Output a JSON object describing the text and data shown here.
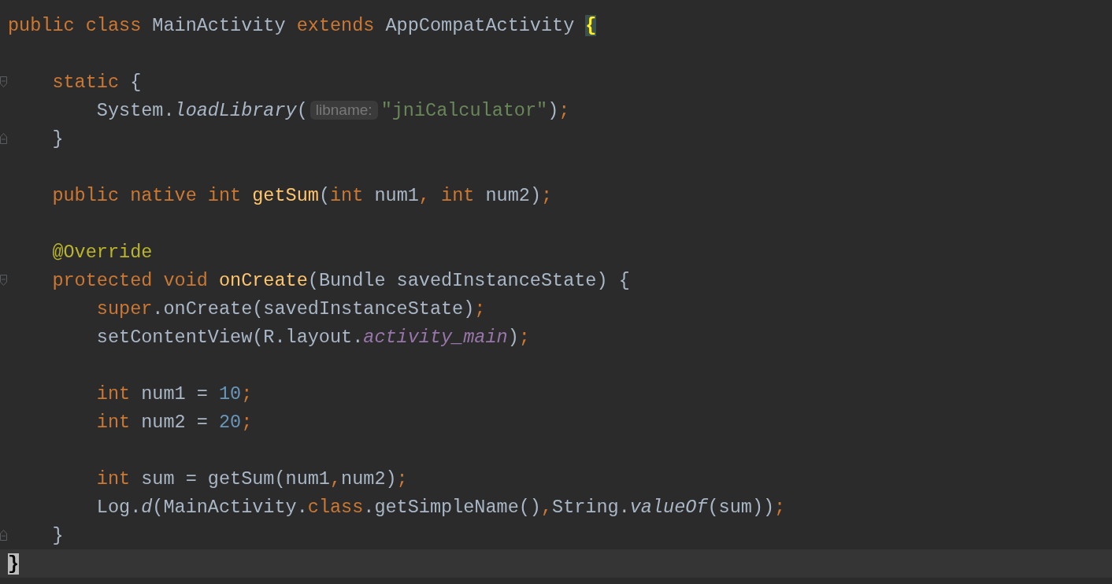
{
  "editor": {
    "lines": [
      {
        "kind": "code",
        "tokens": [
          {
            "text": "public class ",
            "kind": "keyword"
          },
          {
            "text": "MainActivity ",
            "kind": "plain"
          },
          {
            "text": "extends ",
            "kind": "keyword"
          },
          {
            "text": "AppCompatActivity ",
            "kind": "plain"
          },
          {
            "text": "{",
            "kind": "brace-match"
          }
        ]
      },
      {
        "kind": "blank"
      },
      {
        "kind": "code",
        "fold_start": true,
        "tokens": [
          {
            "text": "    static ",
            "kind": "keyword"
          },
          {
            "text": "{",
            "kind": "plain"
          }
        ]
      },
      {
        "kind": "code",
        "tokens": [
          {
            "text": "        System.",
            "kind": "plain"
          },
          {
            "text": "loadLibrary",
            "kind": "italic"
          },
          {
            "text": "(",
            "kind": "plain"
          },
          {
            "text": "libname:",
            "kind": "hint"
          },
          {
            "text": "\"jniCalculator\"",
            "kind": "string"
          },
          {
            "text": ")",
            "kind": "plain"
          },
          {
            "text": ";",
            "kind": "keyword"
          }
        ]
      },
      {
        "kind": "code",
        "fold_end": true,
        "tokens": [
          {
            "text": "    }",
            "kind": "plain"
          }
        ]
      },
      {
        "kind": "blank"
      },
      {
        "kind": "code",
        "tokens": [
          {
            "text": "    public native int ",
            "kind": "keyword"
          },
          {
            "text": "getSum",
            "kind": "method"
          },
          {
            "text": "(",
            "kind": "plain"
          },
          {
            "text": "int ",
            "kind": "keyword"
          },
          {
            "text": "num1",
            "kind": "plain"
          },
          {
            "text": ", ",
            "kind": "keyword"
          },
          {
            "text": "int ",
            "kind": "keyword"
          },
          {
            "text": "num2)",
            "kind": "plain"
          },
          {
            "text": ";",
            "kind": "keyword"
          }
        ]
      },
      {
        "kind": "blank"
      },
      {
        "kind": "code",
        "tokens": [
          {
            "text": "    @Override",
            "kind": "annotation"
          }
        ]
      },
      {
        "kind": "code",
        "fold_start": true,
        "tokens": [
          {
            "text": "    protected void ",
            "kind": "keyword"
          },
          {
            "text": "onCreate",
            "kind": "method"
          },
          {
            "text": "(Bundle savedInstanceState) {",
            "kind": "plain"
          }
        ]
      },
      {
        "kind": "code",
        "tokens": [
          {
            "text": "        super",
            "kind": "keyword"
          },
          {
            "text": ".onCreate(savedInstanceState)",
            "kind": "plain"
          },
          {
            "text": ";",
            "kind": "keyword"
          }
        ]
      },
      {
        "kind": "code",
        "tokens": [
          {
            "text": "        setContentView(R.layout.",
            "kind": "plain"
          },
          {
            "text": "activity_main",
            "kind": "field"
          },
          {
            "text": ")",
            "kind": "plain"
          },
          {
            "text": ";",
            "kind": "keyword"
          }
        ]
      },
      {
        "kind": "blank"
      },
      {
        "kind": "code",
        "tokens": [
          {
            "text": "        int ",
            "kind": "keyword"
          },
          {
            "text": "num1 = ",
            "kind": "plain"
          },
          {
            "text": "10",
            "kind": "number"
          },
          {
            "text": ";",
            "kind": "keyword"
          }
        ]
      },
      {
        "kind": "code",
        "tokens": [
          {
            "text": "        int ",
            "kind": "keyword"
          },
          {
            "text": "num2 = ",
            "kind": "plain"
          },
          {
            "text": "20",
            "kind": "number"
          },
          {
            "text": ";",
            "kind": "keyword"
          }
        ]
      },
      {
        "kind": "blank"
      },
      {
        "kind": "code",
        "tokens": [
          {
            "text": "        int ",
            "kind": "keyword"
          },
          {
            "text": "sum = getSum(num1",
            "kind": "plain"
          },
          {
            "text": ",",
            "kind": "keyword"
          },
          {
            "text": "num2)",
            "kind": "plain"
          },
          {
            "text": ";",
            "kind": "keyword"
          }
        ]
      },
      {
        "kind": "code",
        "tokens": [
          {
            "text": "        Log.",
            "kind": "plain"
          },
          {
            "text": "d",
            "kind": "italic"
          },
          {
            "text": "(MainActivity.",
            "kind": "plain"
          },
          {
            "text": "class",
            "kind": "keyword"
          },
          {
            "text": ".getSimpleName()",
            "kind": "plain"
          },
          {
            "text": ",",
            "kind": "keyword"
          },
          {
            "text": "String.",
            "kind": "plain"
          },
          {
            "text": "valueOf",
            "kind": "italic"
          },
          {
            "text": "(sum))",
            "kind": "plain"
          },
          {
            "text": ";",
            "kind": "keyword"
          }
        ]
      },
      {
        "kind": "code",
        "fold_end": true,
        "tokens": [
          {
            "text": "    }",
            "kind": "plain"
          }
        ]
      },
      {
        "kind": "code",
        "current": true,
        "tokens": [
          {
            "text": "}",
            "kind": "caret-brace"
          }
        ]
      }
    ]
  }
}
